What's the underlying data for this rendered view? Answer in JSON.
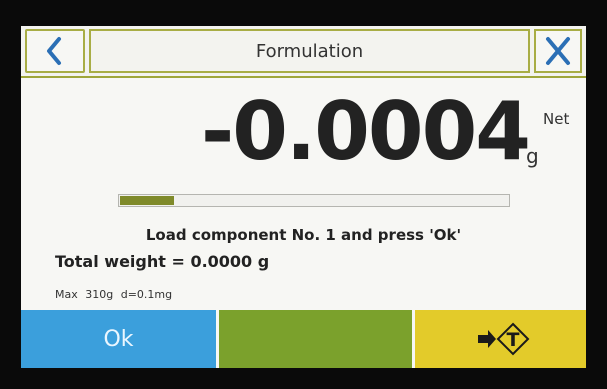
{
  "header": {
    "title": "Formulation",
    "back_icon": "chevron-left-icon",
    "close_icon": "close-icon"
  },
  "display": {
    "weight": "-0.0004",
    "unit": "g",
    "mode": "Net"
  },
  "progress": {
    "fraction": 0.14
  },
  "message": {
    "instruction": "Load component No. 1 and press 'Ok'",
    "total": "Total weight = 0.0000 g"
  },
  "specs": {
    "max": "Max 310g",
    "resolution": "d=0.1mg"
  },
  "footer": {
    "ok_label": "Ok",
    "tare_icon": "tare-icon"
  },
  "colors": {
    "accent": "#a8ad45",
    "ok": "#3b9fdc",
    "middle": "#7ba12c",
    "tare": "#e3cb2a",
    "progress": "#7f8a2a"
  }
}
